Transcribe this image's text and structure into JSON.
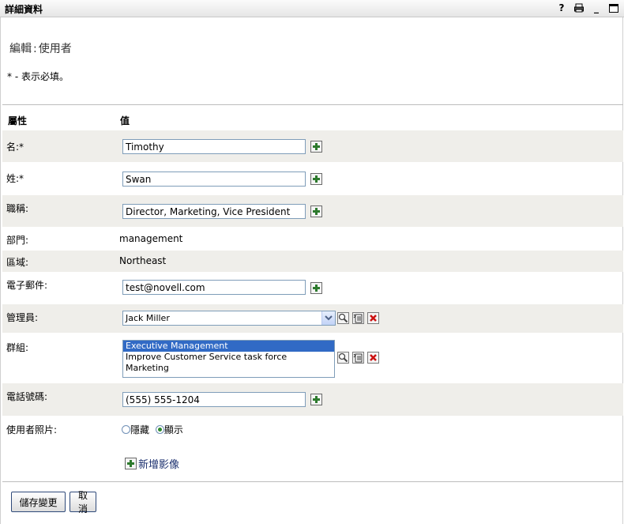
{
  "window": {
    "title": "詳細資料",
    "controls": [
      "help-icon",
      "print-icon",
      "minimize-icon",
      "maximize-icon"
    ],
    "help_glyph": "?",
    "minimize_glyph": "_"
  },
  "header": {
    "edit_label": "編輯",
    "separator": ":",
    "object_type": "使用者",
    "required_note": "* - 表示必填。"
  },
  "table": {
    "col_attribute": "屬性",
    "col_value": "值",
    "first_name": {
      "label": "名:*",
      "value": "Timothy"
    },
    "last_name": {
      "label": "姓:*",
      "value": "Swan"
    },
    "title": {
      "label": "職稱:",
      "value": "Director, Marketing, Vice President"
    },
    "department": {
      "label": "部門:",
      "value": "management"
    },
    "region": {
      "label": "區域:",
      "value": "Northeast"
    },
    "email": {
      "label": "電子郵件:",
      "value": "test@novell.com"
    },
    "manager": {
      "label": "管理員:",
      "value": "Jack Miller"
    },
    "groups": {
      "label": "群組:",
      "items": [
        "Executive Management",
        "Improve Customer Service task force",
        "Marketing"
      ],
      "selected_index": 0
    },
    "phone": {
      "label": "電話號碼:",
      "value": "(555) 555-1204"
    },
    "photo": {
      "label": "使用者照片:",
      "hide_label": "隱藏",
      "show_label": "顯示",
      "selected": "show"
    }
  },
  "add_image_label": "新增影像",
  "buttons": {
    "save": "儲存變更",
    "cancel": "取消"
  },
  "colors": {
    "row_shade": "#efeeea",
    "plus_green": "#2d7a2d",
    "delete_red": "#cc1111",
    "list_selection": "#316ac5"
  }
}
